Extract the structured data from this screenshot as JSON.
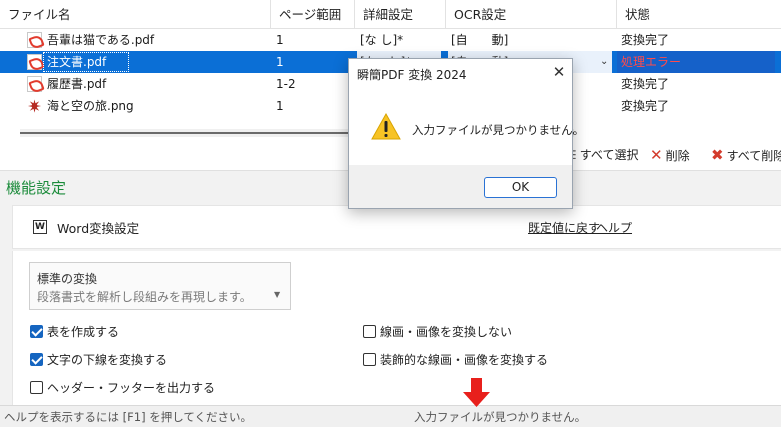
{
  "table": {
    "columns": [
      "ファイル名",
      "ページ範囲",
      "詳細設定",
      "OCR設定",
      "状態"
    ],
    "rows": [
      {
        "name": "吾輩は猫である.pdf",
        "pages": "1",
        "detail": "[な し]*",
        "ocr": "[自　　動]",
        "status": "変換完了",
        "icon": "pdf-file-icon"
      },
      {
        "name": "注文書.pdf",
        "pages": "1",
        "detail": "[な　し]*",
        "ocr": "[自　　動]",
        "status": "処理エラー",
        "icon": "pdf-file-icon"
      },
      {
        "name": "履歴書.pdf",
        "pages": "1-2",
        "detail": "",
        "ocr": "",
        "status": "変換完了",
        "icon": "pdf-file-icon"
      },
      {
        "name": "海と空の旅.png",
        "pages": "1",
        "detail": "",
        "ocr": "",
        "status": "変換完了",
        "icon": "png-file-icon"
      }
    ],
    "selected_index": 1,
    "error_color": "#ff4b4b"
  },
  "actions": {
    "select_all": "すべて選択",
    "delete": "削除",
    "delete_all": "すべて削除"
  },
  "function_settings": {
    "title": "機能設定",
    "title_color": "#1a8b3a",
    "card_title": "Word変換設定",
    "card_icon": "W",
    "reset_link": "既定値に戻す",
    "help_link": "ヘルプ",
    "mode": {
      "label": "標準の変換",
      "description": "段落書式を解析し段組みを再現します。"
    },
    "checkboxes": [
      {
        "label": "表を作成する",
        "checked": true
      },
      {
        "label": "線画・画像を変換しない",
        "checked": false
      },
      {
        "label": "文字の下線を変換する",
        "checked": true
      },
      {
        "label": "装飾的な線画・画像を変換する",
        "checked": false
      },
      {
        "label": "ヘッダー・フッターを出力する",
        "checked": false
      }
    ]
  },
  "status_bar": {
    "help_hint": "ヘルプを表示するには [F1] を押してください。",
    "message": "入力ファイルが見つかりません。"
  },
  "dialog": {
    "title": "瞬簡PDF 変換 2024",
    "message": "入力ファイルが見つかりません。",
    "ok_label": "OK",
    "icon": "warning-icon",
    "accent_color": "#2a72d4"
  }
}
